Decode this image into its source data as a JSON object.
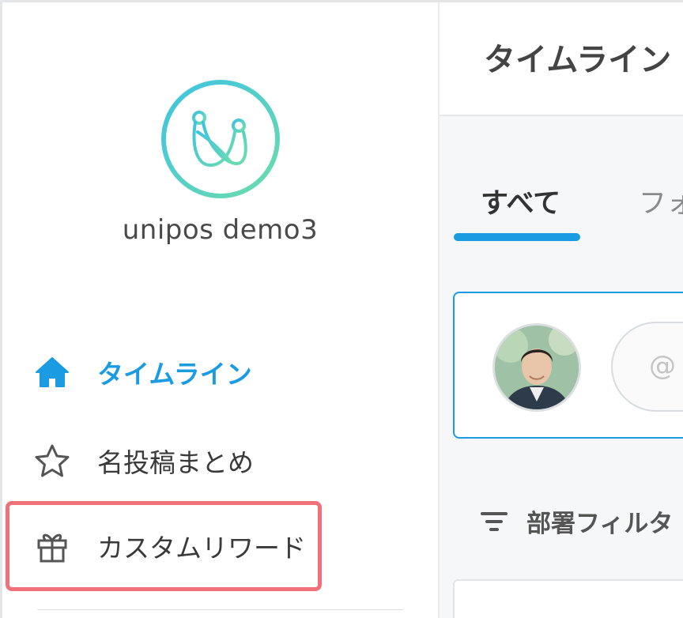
{
  "sidebar": {
    "org_name": "unipos demo3",
    "items": [
      {
        "label": "タイムライン",
        "icon": "home-icon",
        "active": true
      },
      {
        "label": "名投稿まとめ",
        "icon": "star-icon",
        "active": false
      },
      {
        "label": "カスタムリワード",
        "icon": "gift-icon",
        "active": false,
        "highlighted": true
      }
    ]
  },
  "header": {
    "title": "タイムライン"
  },
  "tabs": [
    {
      "label": "すべて",
      "active": true
    },
    {
      "label": "フォ",
      "active": false
    }
  ],
  "composer": {
    "placeholder": "@"
  },
  "filter": {
    "label": "部署フィルタ",
    "paren": "("
  },
  "colors": {
    "accent": "#1a9be2",
    "highlight": "#f0717a",
    "logo_gradient_start": "#3fc3e0",
    "logo_gradient_end": "#6cdcae"
  }
}
